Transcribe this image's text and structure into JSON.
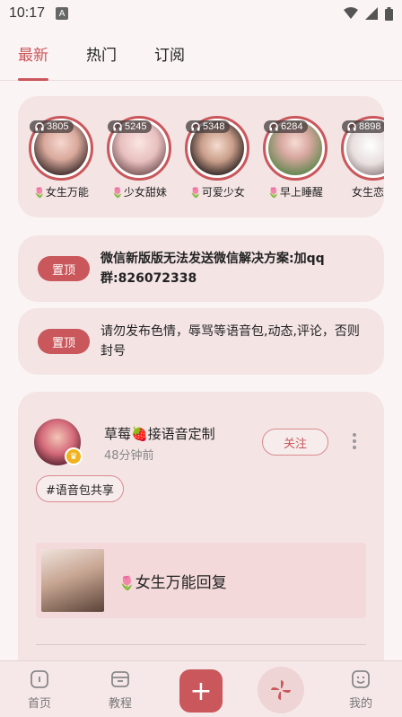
{
  "status": {
    "time": "10:17",
    "a_badge": "A"
  },
  "tabs": [
    {
      "label": "最新",
      "active": true
    },
    {
      "label": "热门",
      "active": false
    },
    {
      "label": "订阅",
      "active": false
    }
  ],
  "rooms": [
    {
      "count": "3805",
      "name": "女生万能"
    },
    {
      "count": "5245",
      "name": "少女甜妹"
    },
    {
      "count": "5348",
      "name": "可爱少女"
    },
    {
      "count": "6284",
      "name": "早上睡醒"
    },
    {
      "count": "8898",
      "name": "女生恋爱"
    }
  ],
  "notices": [
    {
      "pin": "置顶",
      "text": "微信新版版无法发送微信解决方案:加qq群:826072338",
      "bold": true
    },
    {
      "pin": "置顶",
      "text": "请勿发布色情，辱骂等语音包,动态,评论，否则封号",
      "bold": false
    }
  ],
  "post": {
    "username": "草莓🍓接语音定制",
    "time": "48分钟前",
    "follow_label": "关注",
    "tag": "#语音包共享",
    "card_title": "女生万能回复"
  },
  "nav": {
    "home": "首页",
    "tutorial": "教程",
    "add": "+",
    "mine": "我的"
  },
  "colors": {
    "accent": "#c9575b",
    "card_bg": "#f4e4e4",
    "page_bg": "#fbf4f4"
  }
}
